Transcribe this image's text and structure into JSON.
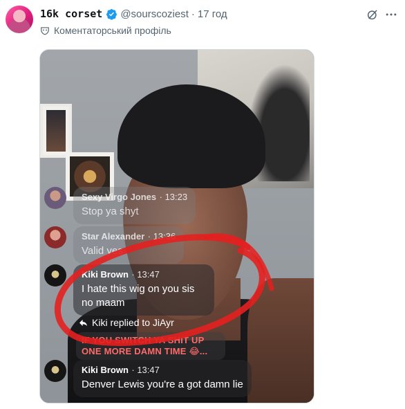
{
  "post": {
    "author_name": "16k corset",
    "handle": "@sourscoziest",
    "separator": "·",
    "time": "17 год",
    "community_label": "Коментаторський профіль"
  },
  "video": {
    "comments": [
      {
        "name": "Sexy Virgo Jones",
        "time": "13:23",
        "text": "Stop ya shyt"
      },
      {
        "name": "Star Alexander",
        "time": "13:36",
        "text": "Valid yes"
      },
      {
        "name": "Kiki Brown",
        "time": "13:47",
        "text": "I hate this wig on you sis no maam"
      },
      {
        "name": "Kiki Brown",
        "time": "13:47",
        "text": "Denver Lewis you're a got damn lie"
      }
    ],
    "reply_text": "Kiki replied to JiAyr",
    "pinned_text": "IF YOU SWITCH YA SHIT UP ONE MORE DAMN TIME 😂..."
  },
  "colors": {
    "verified": "#1d9bf0",
    "muted_text": "#536471",
    "annotation_red": "#e4201f"
  },
  "icons": [
    "verified-badge-icon",
    "grok-icon",
    "more-icon",
    "mask-icon",
    "reply-arrow-icon"
  ]
}
